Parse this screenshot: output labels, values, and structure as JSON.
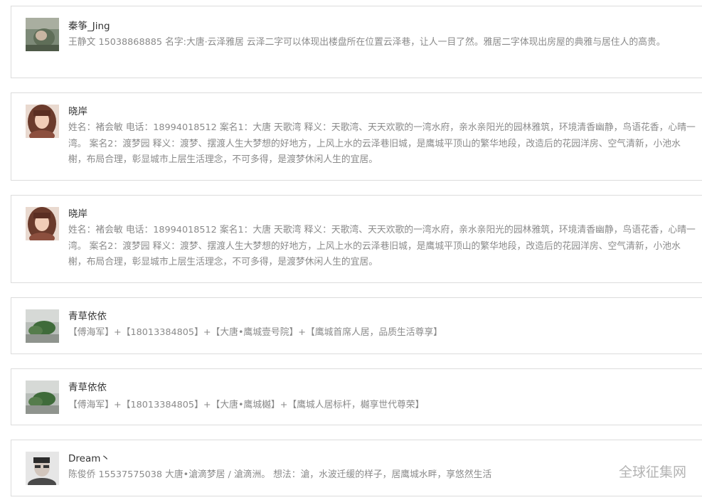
{
  "comments": [
    {
      "username": "秦筝_Jing",
      "avatar_icon": "user-avatar-photo",
      "content": "王静文 15038868885 名字:大唐·云泽雅居 云泽二字可以体现出楼盘所在位置云泽巷，让人一目了然。雅居二字体现出房屋的典雅与居住人的高贵。"
    },
    {
      "username": "晓岸",
      "avatar_icon": "user-avatar-photo",
      "content": "姓名：褚会敏 电话：18994018512 案名1：大唐 天歌湾 释义：天歌湾、天天欢歌的一湾水府，亲水亲阳光的园林雅筑，环境清香幽静，鸟语花香，心晴一湾。 案名2：渡梦园 释义：渡梦、摆渡人生大梦想的好地方，上风上水的云泽巷旧城，是鹰城平顶山的繁华地段，改造后的花园洋房、空气清新，小池水榭，布局合理，彰显城市上层生活理念，不可多得，是渡梦休闲人生的宜居。"
    },
    {
      "username": "晓岸",
      "avatar_icon": "user-avatar-photo",
      "content": "姓名：褚会敏 电话：18994018512 案名1：大唐 天歌湾 释义：天歌湾、天天欢歌的一湾水府，亲水亲阳光的园林雅筑，环境清香幽静，鸟语花香，心晴一湾。 案名2：渡梦园 释义：渡梦、摆渡人生大梦想的好地方，上风上水的云泽巷旧城，是鹰城平顶山的繁华地段，改造后的花园洋房、空气清新，小池水榭，布局合理，彰显城市上层生活理念，不可多得，是渡梦休闲人生的宜居。"
    },
    {
      "username": "青草依依",
      "avatar_icon": "user-avatar-photo",
      "content": "【傅海军】+【18013384805】+【大唐•鹰城壹号院】+【鹰城首席人居，品质生活尊享】"
    },
    {
      "username": "青草依依",
      "avatar_icon": "user-avatar-photo",
      "content": "【傅海军】+【18013384805】+【大唐•鹰城樾】+【鹰城人居标杆，樾享世代尊荣】"
    },
    {
      "username": "Dream丶",
      "avatar_icon": "user-avatar-photo",
      "content": "陈俊侨 15537575038 大唐•滄滴梦居 / 滄滴洲。 想法：滄，水波迁缓的样子，居鹰城水畔，享悠然生活"
    }
  ],
  "watermark": "全球征集网",
  "colors": {
    "border": "#dcdcdc",
    "username": "#333333",
    "content": "#8a8a8a"
  }
}
